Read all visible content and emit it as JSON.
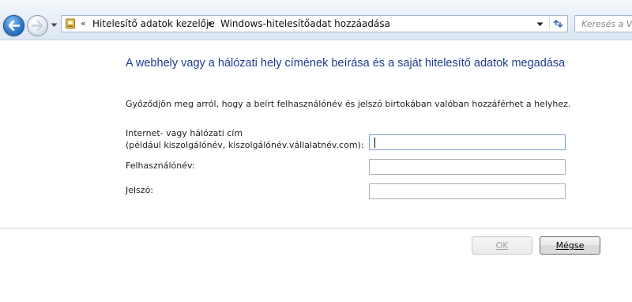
{
  "nav": {
    "breadcrumb_overflow": "«",
    "breadcrumbs": [
      "Hitelesítő adatok kezelője",
      "Windows-hitelesítőadat hozzáadása"
    ],
    "separator": "▸",
    "search_placeholder": "Keresés a Ve"
  },
  "main": {
    "heading": "A webhely vagy a hálózati hely címének beírása és a saját hitelesítő adatok megadása",
    "description": "Győződjön meg arról, hogy a beírt felhasználónév és jelszó birtokában valóban hozzáférhet a helyhez.",
    "fields": {
      "address_label_1": "Internet- vagy hálózati cím",
      "address_label_2": "(például kiszolgálónév, kiszolgálónév.vállalatnév.com):",
      "address_value": "",
      "username_label": "Felhasználónév:",
      "username_value": "",
      "password_label": "Jelszó:",
      "password_value": ""
    }
  },
  "buttons": {
    "ok_label": "OK",
    "cancel_label": "Mégse"
  },
  "icons": {
    "back": "back-arrow-icon",
    "forward": "forward-arrow-icon",
    "history": "chevron-down-icon",
    "folder": "control-panel-folder-icon",
    "refresh": "refresh-icon"
  },
  "colors": {
    "heading": "#1e3d8f",
    "nav_accent": "#3a84d3"
  }
}
